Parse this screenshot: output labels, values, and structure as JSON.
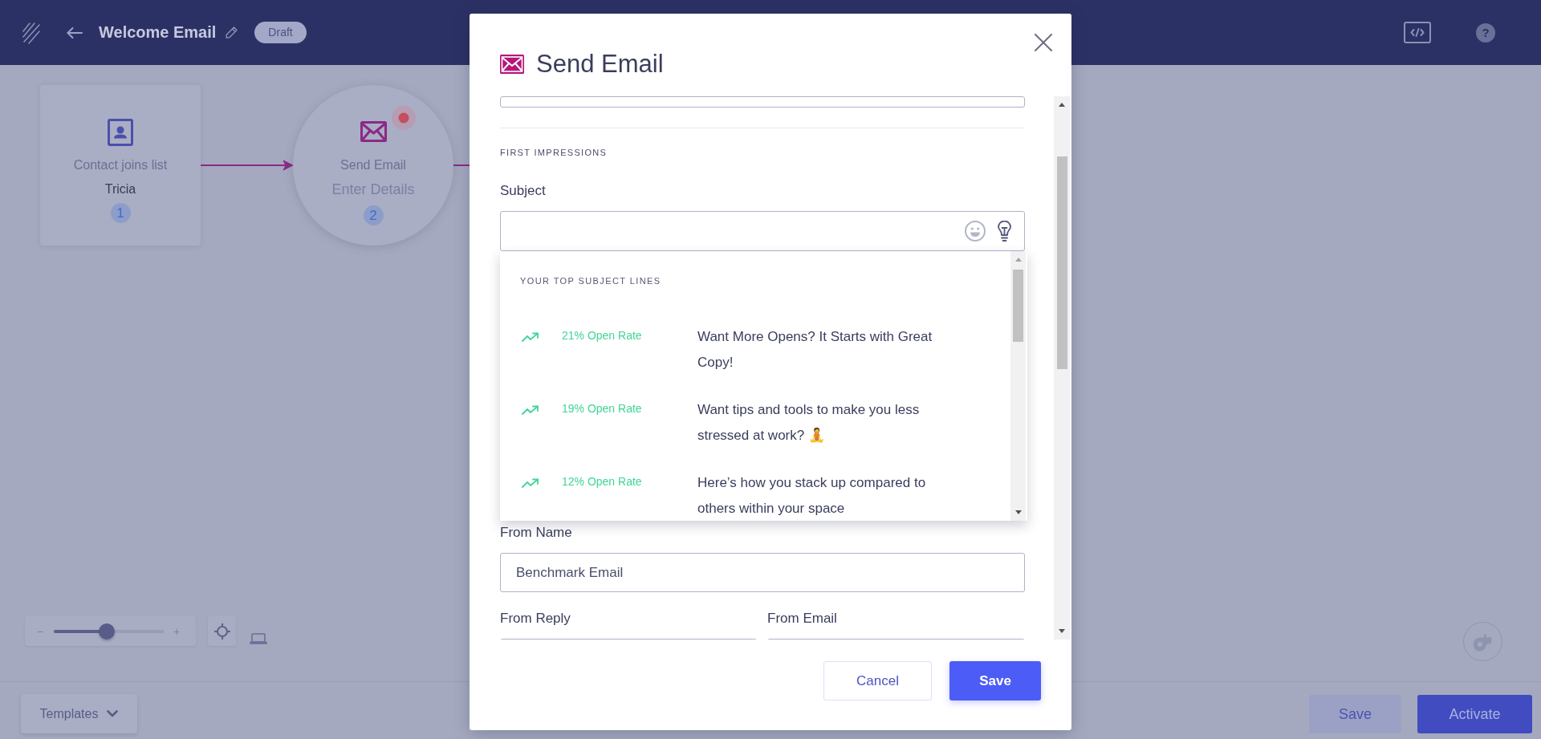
{
  "top_bar": {
    "title": "Welcome Email",
    "status_badge": "Draft",
    "help_label": "?"
  },
  "workflow": {
    "nodes": [
      {
        "kind": "trigger",
        "title": "Contact joins list",
        "detail": "Tricia",
        "step": "1",
        "alert": false
      },
      {
        "kind": "email",
        "title": "Send Email",
        "detail": "Enter Details",
        "step": "2",
        "alert": true
      }
    ]
  },
  "zoom_control": {
    "minus_label": "−",
    "plus_label": "+",
    "level": 0.48
  },
  "bottom_bar": {
    "templates_label": "Templates",
    "buttons": [
      {
        "label": "Save",
        "kind": "secondary"
      },
      {
        "label": "Activate",
        "kind": "primary"
      }
    ]
  },
  "modal": {
    "title": "Send Email",
    "section_heading": "FIRST IMPRESSIONS",
    "subject": {
      "label": "Subject"
    },
    "suggestions": {
      "heading": "YOUR TOP SUBJECT LINES",
      "items": [
        {
          "open_rate": "21% Open Rate",
          "subject": "Want More Opens? It Starts with Great Copy!"
        },
        {
          "open_rate": "19% Open Rate",
          "subject": "Want tips and tools to make you less stressed at work? 🧘"
        },
        {
          "open_rate": "12% Open Rate",
          "subject": "Here’s how you stack up compared to others within your space"
        }
      ]
    },
    "from_name": {
      "label": "From Name",
      "value": "Benchmark Email"
    },
    "from_reply": {
      "label": "From Reply"
    },
    "from_email": {
      "label": "From Email"
    },
    "buttons": [
      {
        "label": "Cancel",
        "kind": "secondary"
      },
      {
        "label": "Save",
        "kind": "primary"
      }
    ]
  }
}
